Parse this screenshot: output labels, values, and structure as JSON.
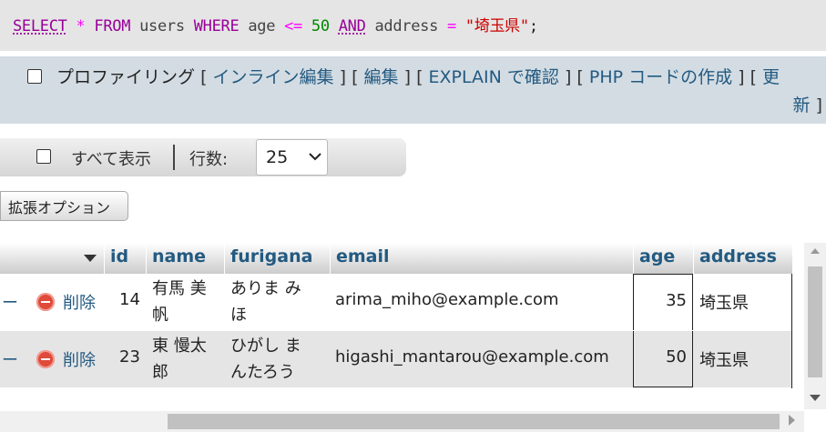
{
  "sql": {
    "tokens": {
      "select": "SELECT",
      "star": "*",
      "from": "FROM",
      "table": "users",
      "where": "WHERE",
      "col_age": "age",
      "op_lte": "<=",
      "num_50": "50",
      "and": "AND",
      "col_address": "address",
      "op_eq": "=",
      "str_value": "\"埼玉県\"",
      "semicolon": ";"
    }
  },
  "profiling": {
    "label": "プロファイリング",
    "bracket_open": "[",
    "bracket_close": "]",
    "links": {
      "inline_edit": "インライン編集",
      "edit": "編集",
      "explain": "EXPLAIN で確認",
      "php_code": "PHP コードの作成",
      "refresh_part1": "更",
      "refresh_part2": "新"
    }
  },
  "navigation": {
    "show_all_label": "すべて表示",
    "rows_label": "行数:",
    "rows_value": "25"
  },
  "extended_options_label": "拡張オプション",
  "table": {
    "columns": {
      "id": "id",
      "name": "name",
      "furigana": "furigana",
      "email": "email",
      "age": "age",
      "address": "address"
    },
    "action_dash": "ー",
    "delete_label": "削除",
    "rows": [
      {
        "id": "14",
        "name_line1": "有馬 美",
        "name_line2": "帆",
        "furigana_line1": "ありま み",
        "furigana_line2": "ほ",
        "email": "arima_miho@example.com",
        "age": "35",
        "address": "埼玉県"
      },
      {
        "id": "23",
        "name_line1": "東 慢太",
        "name_line2": "郎",
        "furigana_line1": "ひがし ま",
        "furigana_line2": "んたろう",
        "email": "higashi_mantarou@example.com",
        "age": "50",
        "address": "埼玉県"
      }
    ]
  }
}
